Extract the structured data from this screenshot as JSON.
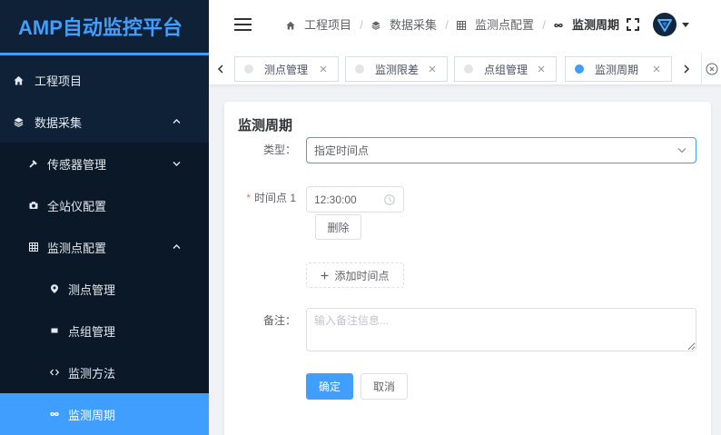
{
  "colors": {
    "accent": "#409eff",
    "sidebar_bg": "#0f2137",
    "submenu_bg": "#0b1828",
    "required": "#f56c6c"
  },
  "app": {
    "title": "AMP自动监控平台"
  },
  "sidebar": {
    "items": [
      {
        "label": "工程项目",
        "icon": "home-icon"
      },
      {
        "label": "数据采集",
        "icon": "layers-icon",
        "expanded": true,
        "children": [
          {
            "label": "传感器管理",
            "icon": "wrench-icon",
            "expanded": false
          },
          {
            "label": "全站仪配置",
            "icon": "camera-icon"
          },
          {
            "label": "监测点配置",
            "icon": "grid-icon",
            "expanded": true,
            "children": [
              {
                "label": "测点管理",
                "icon": "location-icon"
              },
              {
                "label": "点组管理",
                "icon": "square-icon"
              },
              {
                "label": "监测方法",
                "icon": "code-icon"
              },
              {
                "label": "监测周期",
                "icon": "infinity-icon",
                "active": true
              }
            ]
          }
        ]
      }
    ]
  },
  "header": {
    "menu_icon": "hamburger-icon",
    "breadcrumb": [
      {
        "label": "工程项目",
        "icon": "home-icon"
      },
      {
        "label": "数据采集",
        "icon": "layers-icon"
      },
      {
        "label": "监测点配置",
        "icon": "grid-icon"
      },
      {
        "label": "监测周期",
        "icon": "infinity-icon",
        "current": true
      }
    ],
    "separator": "/",
    "fullscreen_icon": "fullscreen-icon",
    "avatar_icon": "avatar-logo-icon",
    "dropdown_icon": "caret-down-icon"
  },
  "tags": {
    "scroll_left_icon": "chevron-left-icon",
    "scroll_right_icon": "chevron-right-icon",
    "close_all_icon": "close-circle-icon",
    "items": [
      {
        "label": "测点管理",
        "active": false
      },
      {
        "label": "监测限差",
        "active": false
      },
      {
        "label": "点组管理",
        "active": false
      },
      {
        "label": "监测周期",
        "active": true
      }
    ]
  },
  "form": {
    "title": "监测周期",
    "type": {
      "label": "类型：",
      "value": "指定时间点"
    },
    "time_points": [
      {
        "required_mark": "*",
        "label": "时间点 1",
        "value": "12:30:00",
        "delete_label": "删除"
      }
    ],
    "add_time_point_label": "添加时间点",
    "remark": {
      "label": "备注：",
      "placeholder": "输入备注信息..."
    },
    "submit_label": "确定",
    "cancel_label": "取消"
  }
}
